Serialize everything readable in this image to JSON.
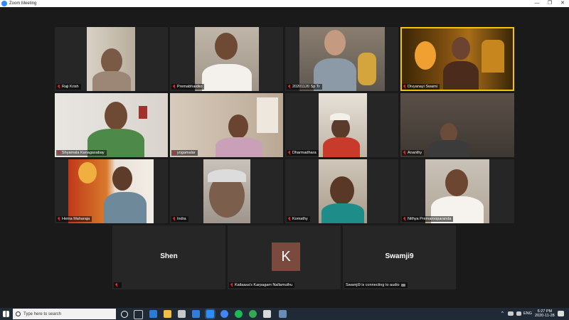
{
  "window": {
    "title": "Zoom Meeting"
  },
  "window_controls": {
    "minimize": "—",
    "maximize": "❐",
    "close": "✕"
  },
  "participants": [
    {
      "name": "Raji Krish",
      "muted": true
    },
    {
      "name": "Premabhaidko",
      "muted": true
    },
    {
      "name": "20201120 Sp Tr",
      "muted": true
    },
    {
      "name": "Divyanayi Swami",
      "muted": true,
      "active_speaker": true
    },
    {
      "name": "Shyamala Kanagasabay",
      "muted": true
    },
    {
      "name": "yogamalar",
      "muted": true
    },
    {
      "name": "Dharmadhara",
      "muted": true
    },
    {
      "name": "Ananthy",
      "muted": true
    },
    {
      "name": "Hema Maharaja",
      "muted": true
    },
    {
      "name": "Indra",
      "muted": true
    },
    {
      "name": "Komathy",
      "muted": true
    },
    {
      "name": "Nithya Premarooparanda",
      "muted": true
    },
    {
      "name": "",
      "big_name": "Shen",
      "muted": true
    },
    {
      "name": "Kailaasa's Karpagam Nallamuthu",
      "avatar_letter": "K",
      "muted": true
    },
    {
      "name": "Swamji9 is connecting to audio",
      "big_name": "Swamji9",
      "muted": false
    }
  ],
  "taskbar": {
    "search_placeholder": "Type here to search",
    "language": "ENG",
    "time": "6:27 PM",
    "date": "2020-11-28"
  },
  "colors": {
    "active_speaker_border": "#f2c500",
    "muted_icon": "#e02424",
    "taskbar": "#1f2a36"
  }
}
